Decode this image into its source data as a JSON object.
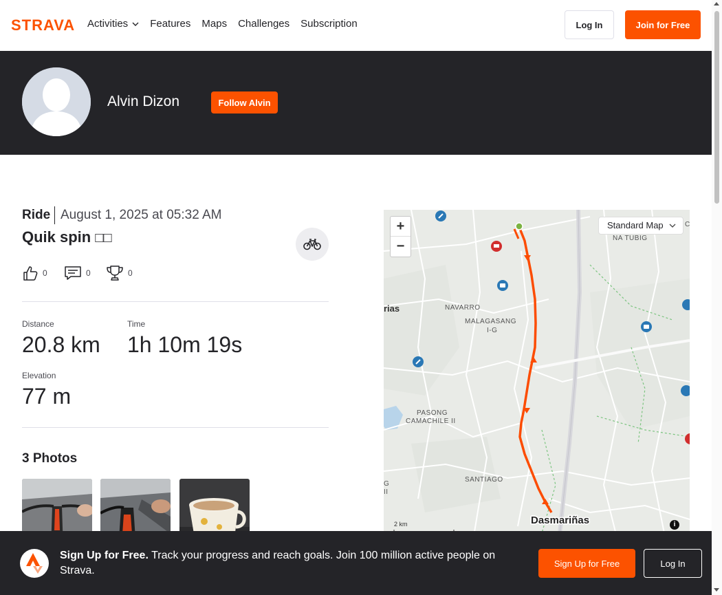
{
  "nav": {
    "logo": "STRAVA",
    "links": [
      "Activities",
      "Features",
      "Maps",
      "Challenges",
      "Subscription"
    ],
    "login_label": "Log In",
    "join_label": "Join for Free"
  },
  "athlete": {
    "name": "Alvin Dizon",
    "follow_label": "Follow Alvin"
  },
  "activity": {
    "type": "Ride",
    "date": "August 1, 2025 at 05:32 AM",
    "title": "Quik spin ",
    "title_glyphs": "□□",
    "kudos": "0",
    "comments": "0",
    "achievements": "0",
    "stats": [
      {
        "label": "Distance",
        "value": "20.8 km"
      },
      {
        "label": "Time",
        "value": "1h 10m 19s"
      },
      {
        "label": "Elevation",
        "value": "77 m"
      }
    ],
    "photos_title": "3 Photos"
  },
  "map": {
    "style_select": "Standard Map",
    "scale": "2 km",
    "info": "i",
    "labels": [
      "NAVARRO",
      "MALAGASANG",
      "I-G",
      "PASONG",
      "CAMACHILE II",
      "SANTIAGO",
      "Dasmariñas",
      "NA TUBIG",
      "rias",
      "G",
      "II",
      "C"
    ],
    "route_color": "#fc4c02"
  },
  "cta": {
    "bold": "Sign Up for Free.",
    "text": " Track your progress and reach goals. Join 100 million active people on Strava.",
    "signup_label": "Sign Up for Free",
    "login_label": "Log In"
  },
  "colors": {
    "brand": "#fc5200",
    "dark": "#242428"
  }
}
